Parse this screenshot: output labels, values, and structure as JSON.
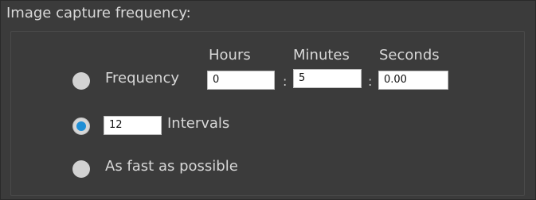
{
  "title": "Image capture frequency:",
  "columns": {
    "hours": "Hours",
    "minutes": "Minutes",
    "seconds": "Seconds"
  },
  "options": {
    "frequency": {
      "label": "Frequency",
      "selected": false
    },
    "intervals": {
      "label": "Intervals",
      "selected": true,
      "value": "12"
    },
    "fastest": {
      "label": "As fast as possible",
      "selected": false
    }
  },
  "time": {
    "hours": "0",
    "minutes": "5",
    "seconds": "0.00",
    "separator": ":"
  },
  "colors": {
    "background": "#3b3b3b",
    "accent": "#1f8fd6",
    "text": "#d8d8d8"
  }
}
